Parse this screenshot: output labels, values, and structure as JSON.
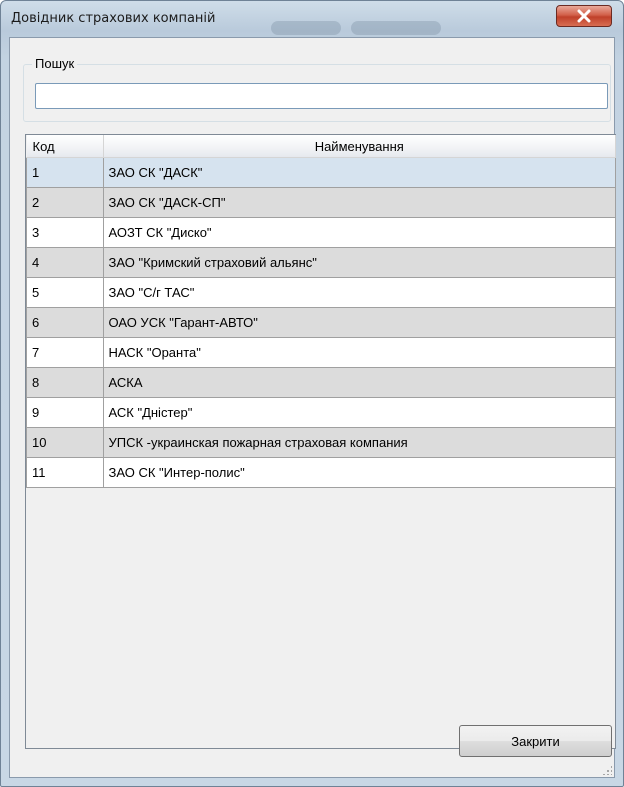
{
  "window": {
    "title": "Довідник страхових компаній",
    "close_icon": "close-icon"
  },
  "search": {
    "legend": "Пошук",
    "value": ""
  },
  "table": {
    "columns": {
      "code": "Код",
      "name": "Найменування"
    },
    "rows": [
      {
        "code": "1",
        "name": "ЗАО СК \"ДАСК\""
      },
      {
        "code": "2",
        "name": "ЗАО СК \"ДАСК-СП\""
      },
      {
        "code": "3",
        "name": "АОЗТ СК \"Диско\""
      },
      {
        "code": "4",
        "name": "ЗАО \"Кримский страховий альянс\""
      },
      {
        "code": "5",
        "name": "ЗАО \"С/г ТАС\""
      },
      {
        "code": "6",
        "name": "ОАО УСК \"Гарант-АВТО\""
      },
      {
        "code": "7",
        "name": "НАСК \"Оранта\""
      },
      {
        "code": "8",
        "name": "АСКА"
      },
      {
        "code": "9",
        "name": "АСК \"Дністер\""
      },
      {
        "code": "10",
        "name": "УПСК -украинская пожарная страховая компания"
      },
      {
        "code": "11",
        "name": "ЗАО СК \"Интер-полис\""
      }
    ]
  },
  "footer": {
    "close_label": "Закрити"
  },
  "colors": {
    "selected_row": "#d6e3ef",
    "alt_row": "#dcdcdc",
    "close_button": "#c0402a"
  }
}
